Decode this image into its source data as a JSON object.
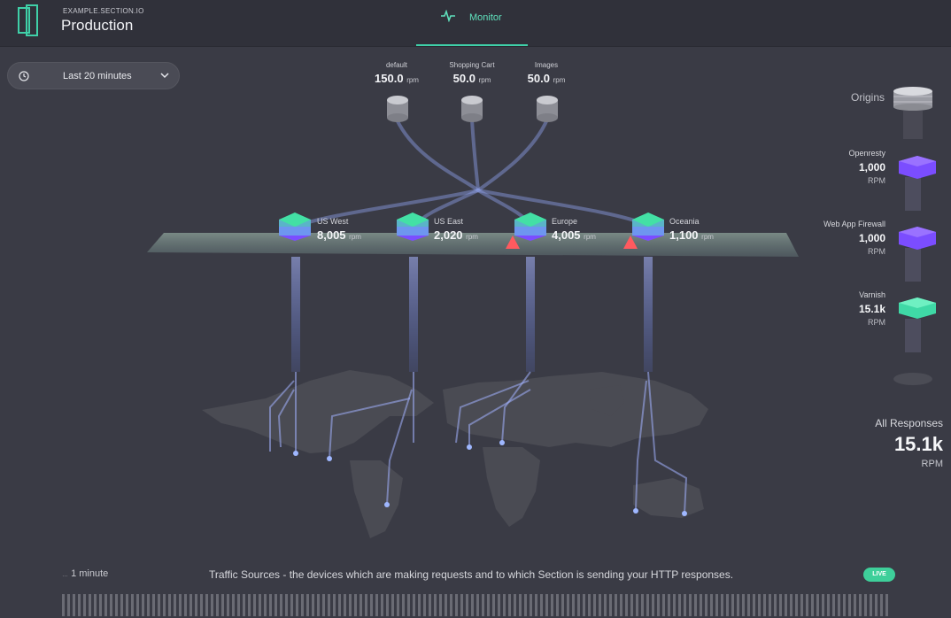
{
  "header": {
    "org": "EXAMPLE.SECTION.IO",
    "environment": "Production",
    "tab_monitor": "Monitor",
    "icons": {
      "logo": "section-logo-icon",
      "monitor": "pulse-icon"
    }
  },
  "time_filter": {
    "value": "Last 20 minutes",
    "icon": "clock-icon",
    "chevron": "chevron-down-icon"
  },
  "origins": [
    {
      "name": "default",
      "rpm": "150.0",
      "unit": "rpm"
    },
    {
      "name": "Shopping Cart",
      "rpm": "50.0",
      "unit": "rpm"
    },
    {
      "name": "Images",
      "rpm": "50.0",
      "unit": "rpm"
    }
  ],
  "regions": [
    {
      "name": "US West",
      "rpm": "8,005",
      "unit": "rpm",
      "alert": false
    },
    {
      "name": "US East",
      "rpm": "2,020",
      "unit": "rpm",
      "alert": false
    },
    {
      "name": "Europe",
      "rpm": "4,005",
      "unit": "rpm",
      "alert": true
    },
    {
      "name": "Oceania",
      "rpm": "1,100",
      "unit": "rpm",
      "alert": true
    }
  ],
  "legend": {
    "origins_label": "Origins",
    "items": [
      {
        "name": "Openresty",
        "value": "1,000",
        "unit": "RPM",
        "color": "#7b4dff"
      },
      {
        "name": "Web App Firewall",
        "value": "1,000",
        "unit": "RPM",
        "color": "#7b4dff"
      },
      {
        "name": "Varnish",
        "value": "15.1k",
        "unit": "RPM",
        "color": "#3fd9a6"
      }
    ]
  },
  "all_responses": {
    "label": "All Responses",
    "value": "15.1k",
    "unit": "RPM"
  },
  "footer": {
    "interval": "1 minute",
    "caption": "Traffic Sources - the devices which are making requests and to which Section is sending your HTTP responses.",
    "live_badge": "LIVE"
  },
  "colors": {
    "accent": "#3fd0a8",
    "background": "#3a3b45",
    "topbar": "#30313a",
    "alert": "#ff5a5f"
  }
}
